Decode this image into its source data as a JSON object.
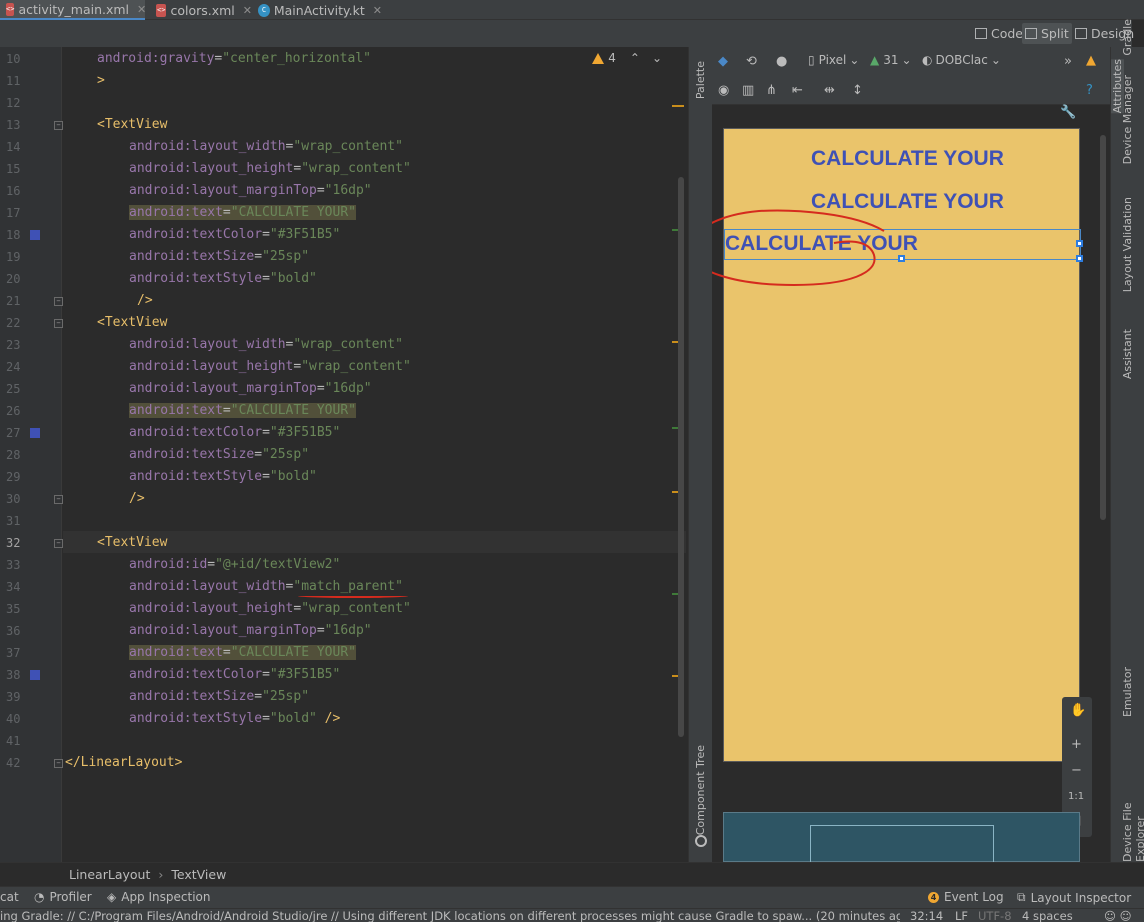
{
  "tabs": [
    {
      "label": "activity_main.xml",
      "icon": "xml-file-icon",
      "active": true
    },
    {
      "label": "colors.xml",
      "icon": "xml-file-icon",
      "active": false
    },
    {
      "label": "MainActivity.kt",
      "icon": "kotlin-file-icon",
      "active": false
    }
  ],
  "view_modes": {
    "code": "Code",
    "split": "Split",
    "design": "Design",
    "selected": "Split"
  },
  "editor": {
    "warning_count": "4",
    "lines": [
      {
        "num": "10",
        "text": "android:gravity=\"center_horizontal\""
      },
      {
        "num": "11",
        "text": ">"
      },
      {
        "num": "12",
        "text": ""
      },
      {
        "num": "13",
        "text": "<TextView"
      },
      {
        "num": "14",
        "text": "android:layout_width=\"wrap_content\""
      },
      {
        "num": "15",
        "text": "android:layout_height=\"wrap_content\""
      },
      {
        "num": "16",
        "text": "android:layout_marginTop=\"16dp\""
      },
      {
        "num": "17",
        "text": "android:text=\"CALCULATE YOUR\""
      },
      {
        "num": "18",
        "text": "android:textColor=\"#3F51B5\""
      },
      {
        "num": "19",
        "text": "android:textSize=\"25sp\""
      },
      {
        "num": "20",
        "text": "android:textStyle=\"bold\""
      },
      {
        "num": "21",
        "text": "/>"
      },
      {
        "num": "22",
        "text": "<TextView"
      },
      {
        "num": "23",
        "text": "android:layout_width=\"wrap_content\""
      },
      {
        "num": "24",
        "text": "android:layout_height=\"wrap_content\""
      },
      {
        "num": "25",
        "text": "android:layout_marginTop=\"16dp\""
      },
      {
        "num": "26",
        "text": "android:text=\"CALCULATE YOUR\""
      },
      {
        "num": "27",
        "text": "android:textColor=\"#3F51B5\""
      },
      {
        "num": "28",
        "text": "android:textSize=\"25sp\""
      },
      {
        "num": "29",
        "text": "android:textStyle=\"bold\""
      },
      {
        "num": "30",
        "text": "/>"
      },
      {
        "num": "31",
        "text": ""
      },
      {
        "num": "32",
        "text": "<TextView"
      },
      {
        "num": "33",
        "text": "android:id=\"@+id/textView2\""
      },
      {
        "num": "34",
        "text": "android:layout_width=\"match_parent\""
      },
      {
        "num": "35",
        "text": "android:layout_height=\"wrap_content\""
      },
      {
        "num": "36",
        "text": "android:layout_marginTop=\"16dp\""
      },
      {
        "num": "37",
        "text": "android:text=\"CALCULATE YOUR\""
      },
      {
        "num": "38",
        "text": "android:textColor=\"#3F51B5\""
      },
      {
        "num": "39",
        "text": "android:textSize=\"25sp\""
      },
      {
        "num": "40",
        "text": "android:textStyle=\"bold\" />"
      },
      {
        "num": "41",
        "text": ""
      },
      {
        "num": "42",
        "text": "</LinearLayout>"
      }
    ],
    "current_line": "32",
    "color_swatch": "#3F51B5"
  },
  "design": {
    "device": "Pixel",
    "api": "31",
    "theme": "DOBClac",
    "palette_label": "Palette",
    "component_tree_label": "Component Tree",
    "preview_texts": [
      "CALCULATE YOUR",
      "CALCULATE YOUR",
      "CALCULATE YOUR"
    ],
    "preview_bg": "#EAC46B",
    "text_color": "#3F51B5",
    "zoom_fit_label": "1:1"
  },
  "right_panels": [
    "Gradle",
    "Device Manager",
    "Attributes",
    "Layout Validation",
    "Assistant",
    "Emulator",
    "Device File Explorer"
  ],
  "breadcrumb": [
    "LinearLayout",
    "TextView"
  ],
  "tool_windows": {
    "left": [
      "cat",
      "Profiler",
      "App Inspection"
    ],
    "event_log": "Event Log",
    "event_log_count": "4",
    "layout_inspector": "Layout Inspector"
  },
  "status": {
    "message": "ing Gradle: // C:/Program Files/Android/Android Studio/jre // Using different JDK locations on different processes might cause Gradle to spaw... (20 minutes ago)",
    "position": "32:14",
    "line_sep": "LF",
    "encoding": "UTF-8",
    "indent": "4 spaces"
  }
}
